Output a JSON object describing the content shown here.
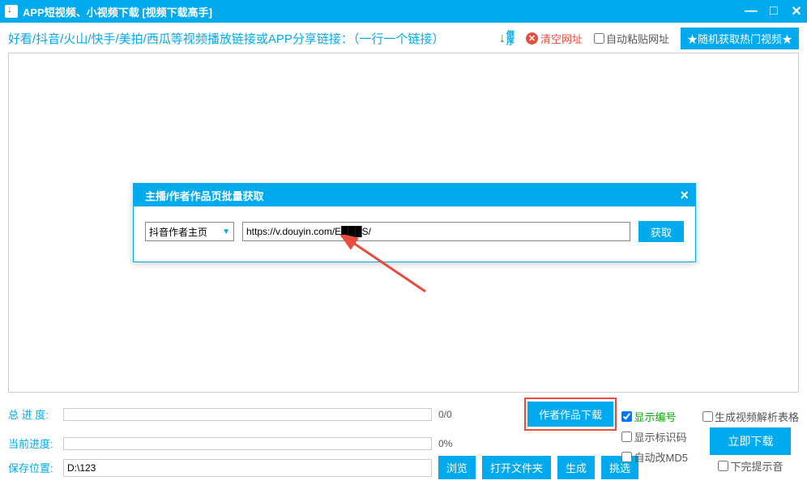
{
  "window": {
    "title": "APP短视频、小视频下载 [视频下载高手]"
  },
  "top": {
    "hint": "好看/抖音/火山/快手/美拍/西瓜等视频播放链接或APP分享链接：（一行一个链接）",
    "sort_label1": "倒",
    "sort_label2": "序",
    "clear_label": "清空网址",
    "auto_paste_label": "自动粘贴网址",
    "random_btn": "★随机获取热门视频★"
  },
  "modal": {
    "title": "主播/作者作品页批量获取",
    "select_value": "抖音作者主页",
    "url_value": "https://v.douyin.com/E███S/",
    "get_btn": "获取"
  },
  "bottom": {
    "total_label": "总 进 度:",
    "total_value": "0/0",
    "current_label": "当前进度:",
    "current_value": "0%",
    "save_label": "保存位置:",
    "save_value": "D:\\123",
    "browse_btn": "浏览",
    "open_folder_btn": "打开文件夹",
    "gen_btn": "生成",
    "pick_btn": "挑选",
    "author_btn": "作者作品下载",
    "show_num": "显示编号",
    "show_id": "显示标识码",
    "auto_md5": "自动改MD5",
    "gen_table": "生成视频解析表格",
    "download_btn": "立即下载",
    "done_sound": "下完提示音"
  }
}
